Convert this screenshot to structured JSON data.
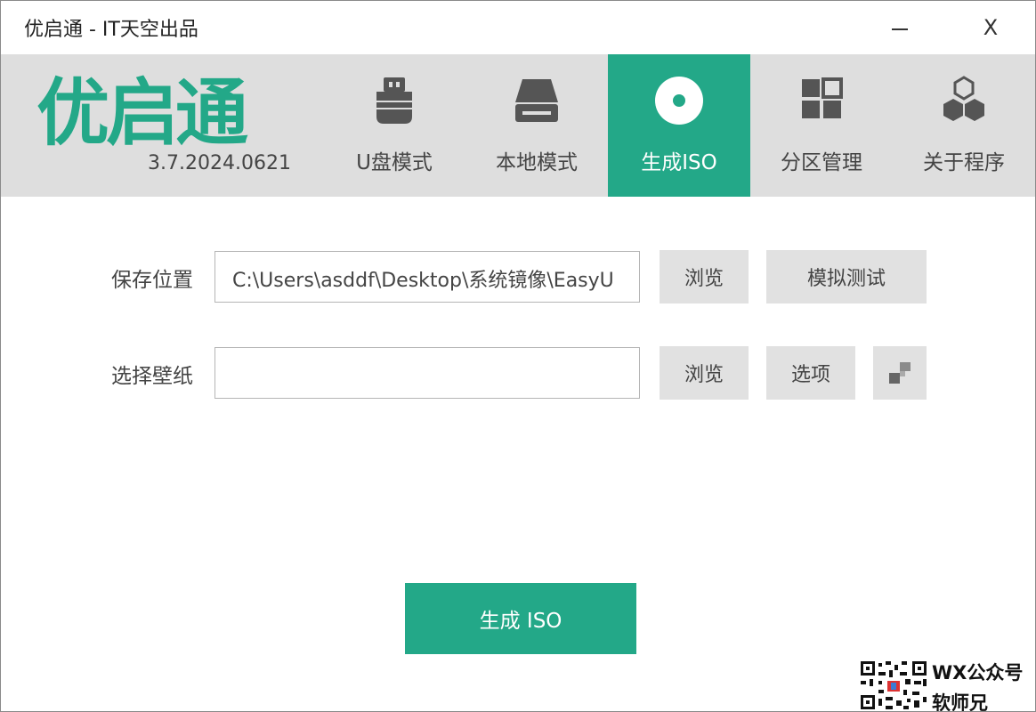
{
  "window": {
    "title": "优启通 - IT天空出品",
    "close_glyph": "X"
  },
  "brand": {
    "logo_text": "优启通",
    "version": "3.7.2024.0621",
    "accent_color": "#23a888"
  },
  "tabs": [
    {
      "label": "U盘模式",
      "icon": "usb-drive-icon",
      "active": false
    },
    {
      "label": "本地模式",
      "icon": "hard-drive-icon",
      "active": false
    },
    {
      "label": "生成ISO",
      "icon": "disc-icon",
      "active": true
    },
    {
      "label": "分区管理",
      "icon": "partition-grid-icon",
      "active": false
    },
    {
      "label": "关于程序",
      "icon": "hexagons-icon",
      "active": false
    }
  ],
  "form": {
    "save_location": {
      "label": "保存位置",
      "value": "C:\\Users\\asddf\\Desktop\\系统镜像\\EasyU",
      "browse_label": "浏览",
      "test_label": "模拟测试"
    },
    "wallpaper": {
      "label": "选择壁纸",
      "value": "",
      "browse_label": "浏览",
      "options_label": "选项",
      "extra_icon": "checker-icon"
    }
  },
  "action": {
    "generate_label": "生成 ISO"
  },
  "watermark": {
    "line1": "WX公众号",
    "line2": "软师兄"
  }
}
